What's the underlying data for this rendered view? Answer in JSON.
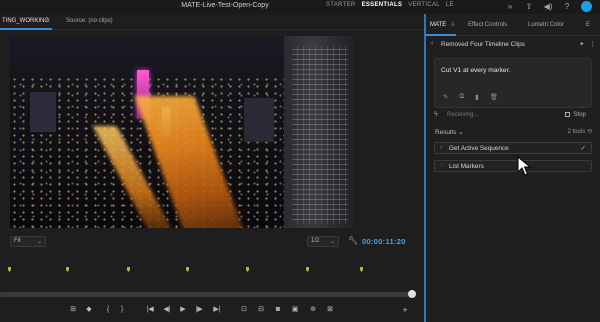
{
  "window": {
    "title": "MATE-Live-Test-Open-Copy",
    "workspaces": [
      "STARTER",
      "ESSENTIALS",
      "VERTICAL",
      "LE"
    ],
    "active_workspace": "ESSENTIALS"
  },
  "monitor": {
    "tabs": [
      {
        "label": "TING_WORKING",
        "active": true
      },
      {
        "label": "Source: (no clips)",
        "active": false
      }
    ],
    "fit_label": "Fit",
    "resolution_label": "1/2",
    "timecode": "00:00:11:20"
  },
  "panel": {
    "tabs": [
      {
        "label": "MATE",
        "active": true
      },
      {
        "label": "Effect Controls",
        "active": false
      },
      {
        "label": "Lumetri Color",
        "active": false
      },
      {
        "label": "E",
        "active": false
      }
    ],
    "conversation_title": "Removed Four Timeline Clips",
    "prompt_text": "Cut V1 at every marker.",
    "status_text": "Receiving...",
    "stop_label": "Stop",
    "results_label": "Results",
    "tools_count": "2 tools",
    "tools": [
      {
        "name": "Get Active Sequence",
        "state": "done"
      },
      {
        "name": "List Markers",
        "state": "running"
      }
    ]
  },
  "colors": {
    "accent_blue": "#3b8fd6",
    "timecode_blue": "#4ea1e8",
    "avatar_blue": "#1aa0e8",
    "marker_yellow": "#c2b030"
  }
}
